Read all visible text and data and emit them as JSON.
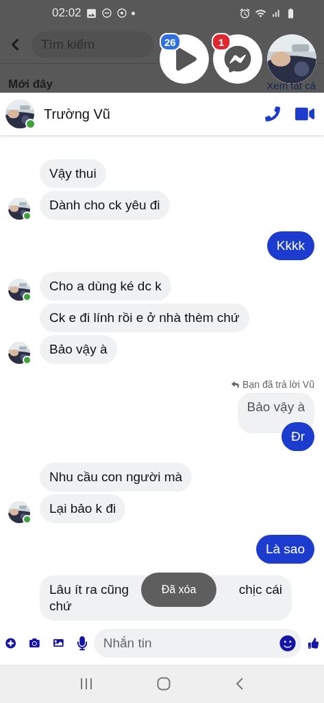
{
  "status_bar": {
    "time": "02:02"
  },
  "search": {
    "placeholder": "Tìm kiếm"
  },
  "section": {
    "title": "Mới đây",
    "link": "Xem tất cả"
  },
  "chat_heads": [
    {
      "kind": "play",
      "badge": "26",
      "color": "#2f6fe4"
    },
    {
      "kind": "messenger",
      "badge": "1",
      "color": "#e0262e"
    },
    {
      "kind": "picture"
    }
  ],
  "chat": {
    "name": "Trường Vũ",
    "online": true
  },
  "messages": [
    {
      "kind": "incoming",
      "text": "Vậy thui",
      "avatar": false
    },
    {
      "kind": "incoming",
      "text": "Dành cho ck yêu đi",
      "avatar": true
    },
    {
      "kind": "outgoing",
      "text": "Kkkk"
    },
    {
      "kind": "incoming",
      "text": "Cho a dùng ké dc k",
      "avatar": true
    },
    {
      "kind": "incoming",
      "text": "Ck e đi lính rồi e ở nhà thèm chứ",
      "avatar": false
    },
    {
      "kind": "incoming",
      "text": "Bảo vậy à",
      "avatar": true
    },
    {
      "kind": "reply_note",
      "text": "Bạn đã trả lời Vũ"
    },
    {
      "kind": "quoted",
      "text": "Bảo vậy à"
    },
    {
      "kind": "outgoing",
      "text": "Đr"
    },
    {
      "kind": "incoming",
      "text": "Nhu cầu con người mà",
      "avatar": false
    },
    {
      "kind": "incoming",
      "text": "Lại bảo k đi",
      "avatar": true
    },
    {
      "kind": "outgoing",
      "text": "Là sao"
    },
    {
      "kind": "covered",
      "parts": [
        "Lâu ít ra cũng",
        "chịc cái",
        "chứ"
      ],
      "avatar": false
    }
  ],
  "toast": "Đã xóa",
  "composer": {
    "placeholder": "Nhắn tin"
  }
}
